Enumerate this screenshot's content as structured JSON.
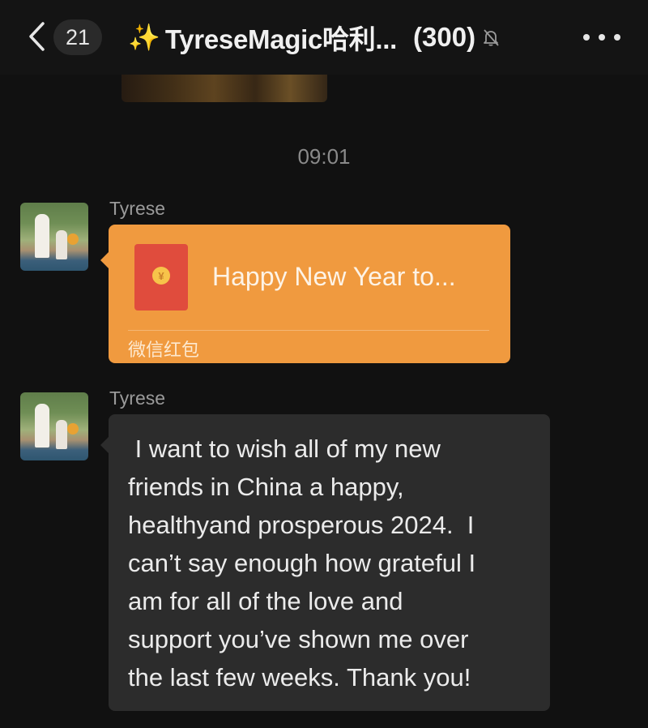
{
  "header": {
    "unread_count": "21",
    "title_emoji": "✨",
    "title": "TyreseMagic哈利...",
    "member_count": "(300)"
  },
  "icons": {
    "back": "chevron-left-icon",
    "mute": "bell-slash-icon",
    "more": "more-dots-icon",
    "red_packet": "red-packet-icon"
  },
  "timestamp": "09:01",
  "messages": [
    {
      "sender": "Tyrese",
      "type": "red_packet",
      "packet_title": "Happy New Year to...",
      "packet_footer": "微信红包",
      "packet_coin": "¥"
    },
    {
      "sender": "Tyrese",
      "type": "text",
      "lines": [
        " I want to wish all of my new",
        "friends in China a happy,",
        "healthyand prosperous 2024.  I",
        "can’t say enough how grateful I",
        "am for all of the love and",
        "support you’ve shown me over",
        "the last few weeks. Thank you!"
      ]
    }
  ],
  "colors": {
    "background": "#111111",
    "packet": "#f09a3f",
    "envelope": "#e04c3d",
    "text_bubble": "#2c2c2c"
  }
}
